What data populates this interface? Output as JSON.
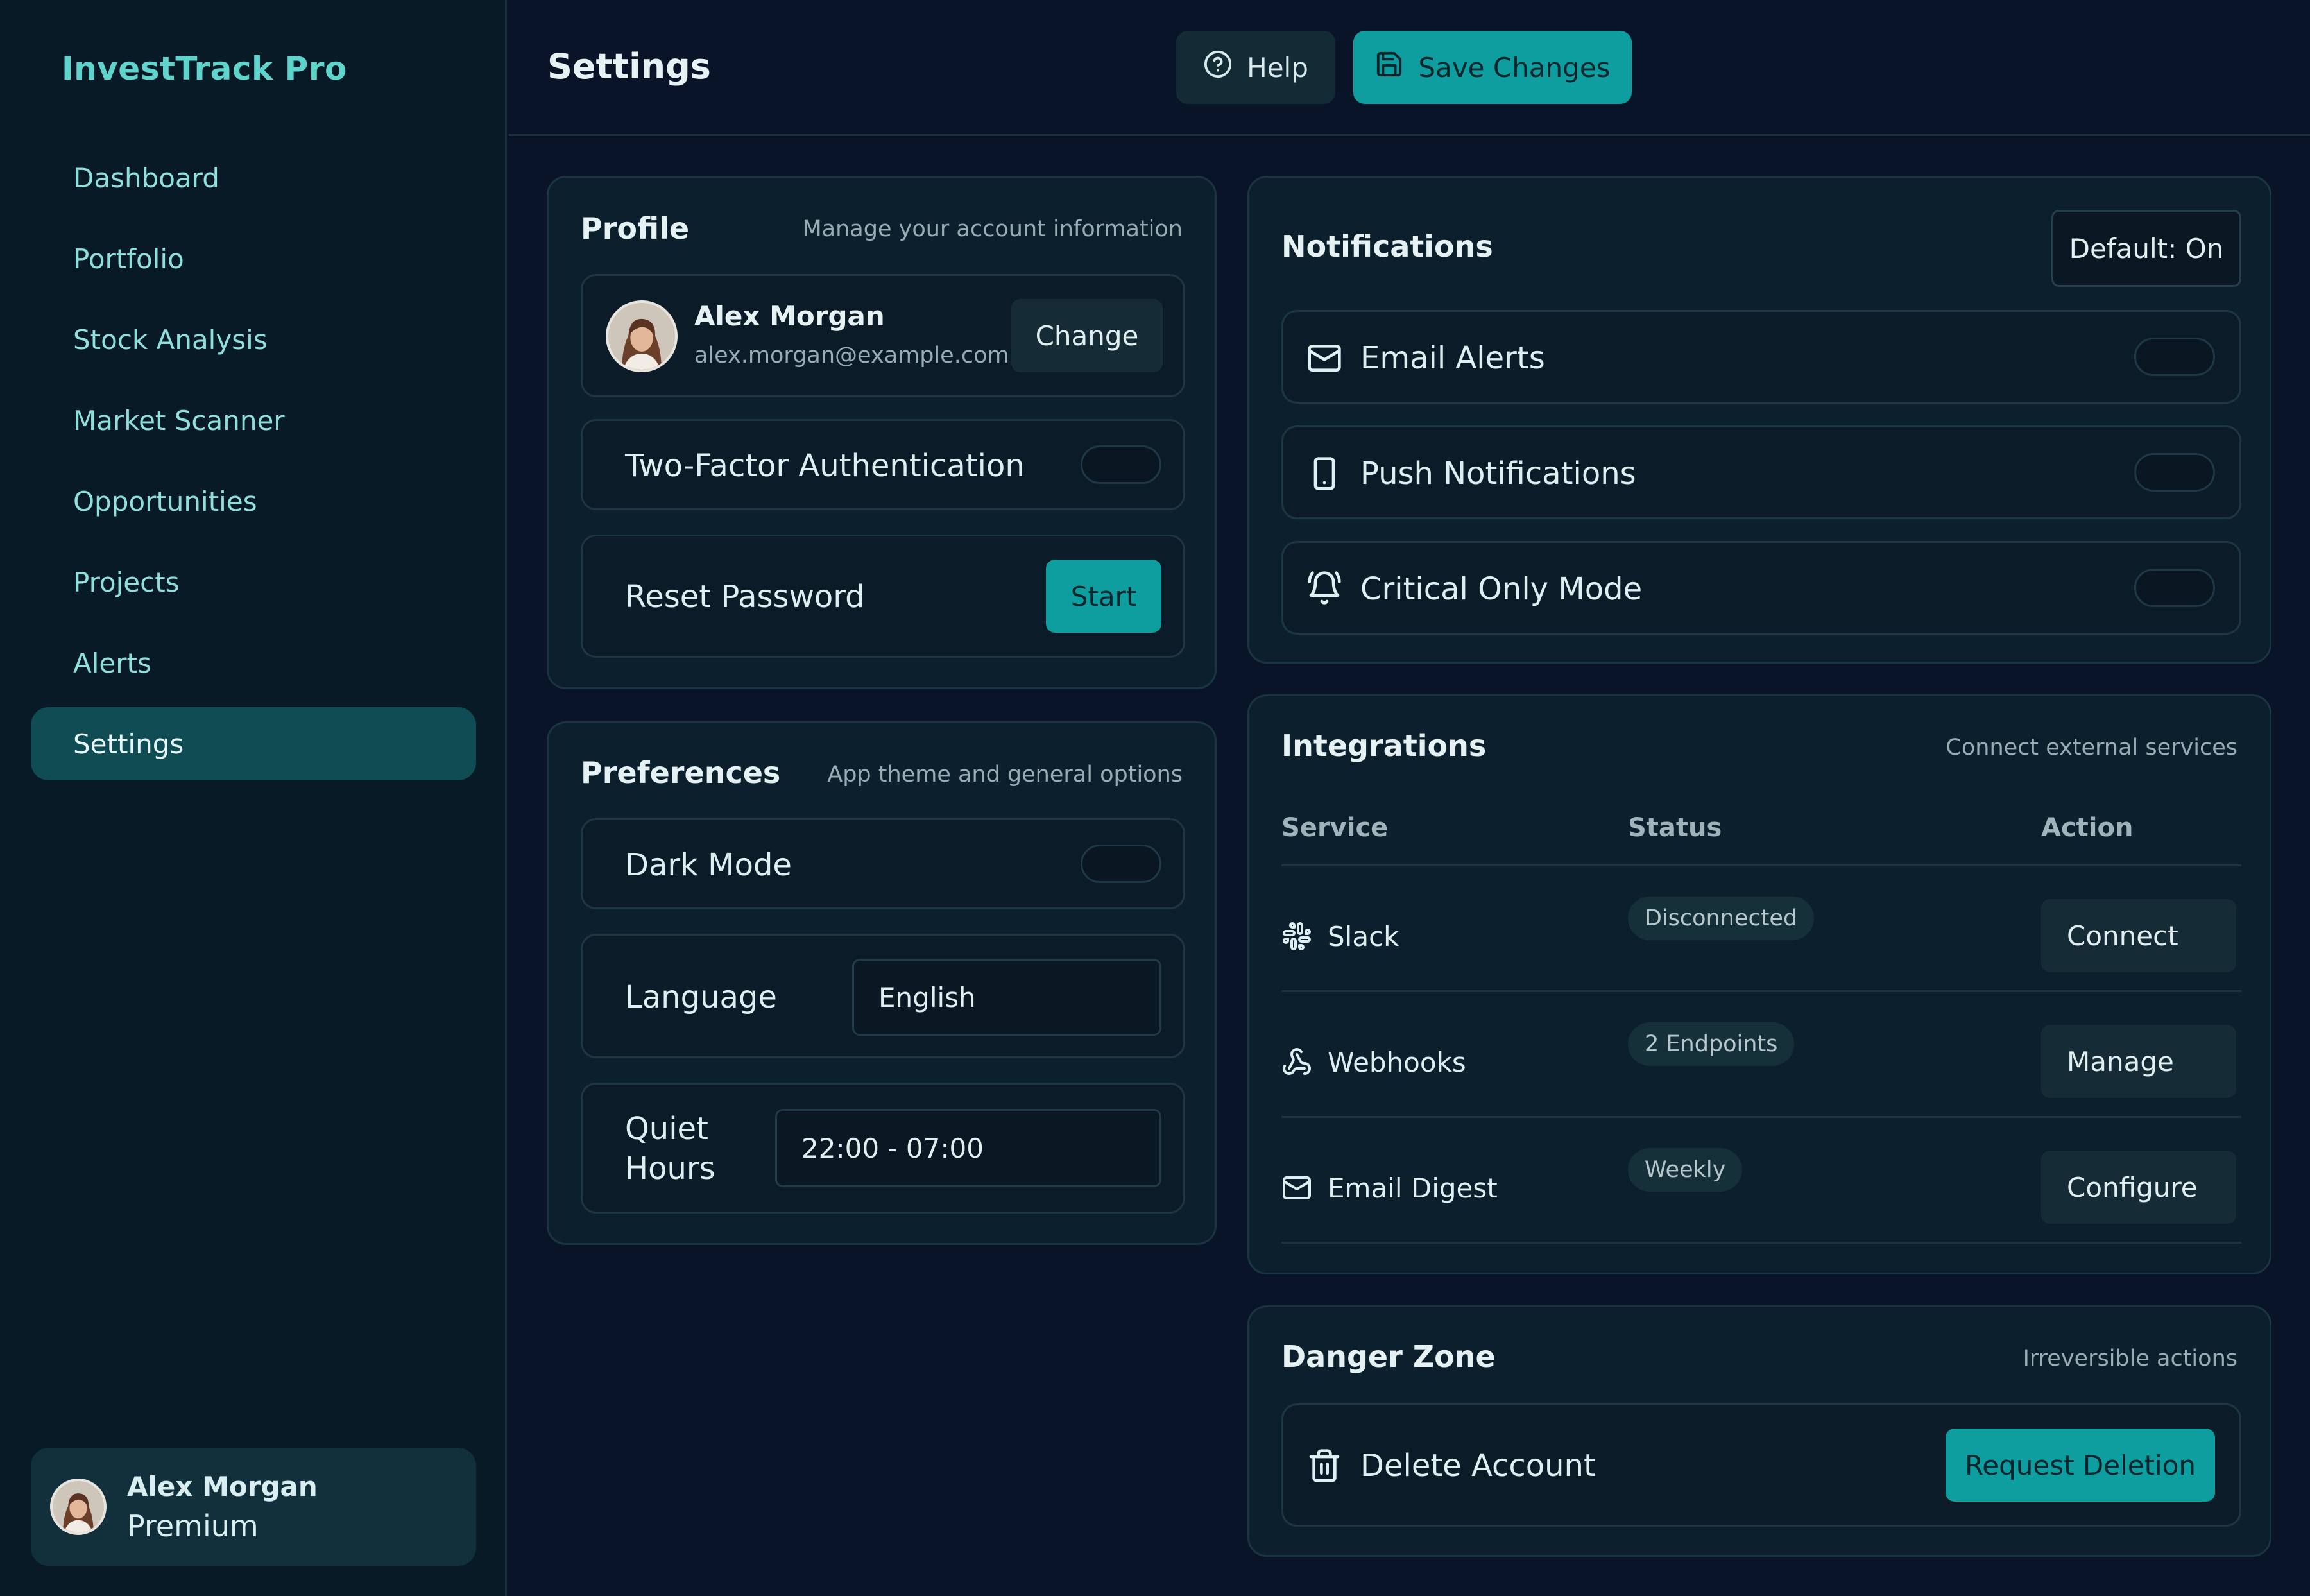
{
  "app": {
    "brand": "InvestTrack Pro"
  },
  "sidebar": {
    "items": [
      {
        "label": "Dashboard"
      },
      {
        "label": "Portfolio"
      },
      {
        "label": "Stock Analysis"
      },
      {
        "label": "Market Scanner"
      },
      {
        "label": "Opportunities"
      },
      {
        "label": "Projects"
      },
      {
        "label": "Alerts"
      },
      {
        "label": "Settings",
        "active": true
      }
    ],
    "user": {
      "name": "Alex Morgan",
      "plan": "Premium"
    }
  },
  "header": {
    "title": "Settings",
    "help_label": "Help",
    "save_label": "Save Changes"
  },
  "profile": {
    "title": "Profile",
    "subtitle": "Manage your account information",
    "name": "Alex Morgan",
    "email": "alex.morgan@example.com",
    "change_label": "Change",
    "two_factor_label": "Two-Factor Authentication",
    "two_factor_on": false,
    "reset_label": "Reset Password",
    "reset_button": "Start"
  },
  "preferences": {
    "title": "Preferences",
    "subtitle": "App theme and general options",
    "dark_mode_label": "Dark Mode",
    "dark_mode_on": false,
    "language_label": "Language",
    "language_value": "English",
    "quiet_hours_label_1": "Quiet",
    "quiet_hours_label_2": "Hours",
    "quiet_hours_value": "22:00 - 07:00"
  },
  "notifications": {
    "title": "Notifications",
    "default_label": "Default: On",
    "items": [
      {
        "label": "Email Alerts",
        "icon": "mail-icon",
        "on": false
      },
      {
        "label": "Push Notifications",
        "icon": "smartphone-icon",
        "on": false
      },
      {
        "label": "Critical Only Mode",
        "icon": "bell-ring-icon",
        "on": false
      }
    ]
  },
  "integrations": {
    "title": "Integrations",
    "subtitle": "Connect external services",
    "columns": {
      "service": "Service",
      "status": "Status",
      "action": "Action"
    },
    "rows": [
      {
        "service": "Slack",
        "icon": "slack-icon",
        "status": "Disconnected",
        "action": "Connect"
      },
      {
        "service": "Webhooks",
        "icon": "webhook-icon",
        "status": "2 Endpoints",
        "action": "Manage"
      },
      {
        "service": "Email Digest",
        "icon": "mail-icon",
        "status": "Weekly",
        "action": "Configure"
      }
    ]
  },
  "danger": {
    "title": "Danger Zone",
    "subtitle": "Irreversible actions",
    "delete_label": "Delete Account",
    "delete_button": "Request Deletion"
  },
  "colors": {
    "accent": "#0f9ea0",
    "brand": "#5fd4cd",
    "background": "#0a1428",
    "sidebar": "#081a26",
    "card": "#0c1f2d"
  }
}
